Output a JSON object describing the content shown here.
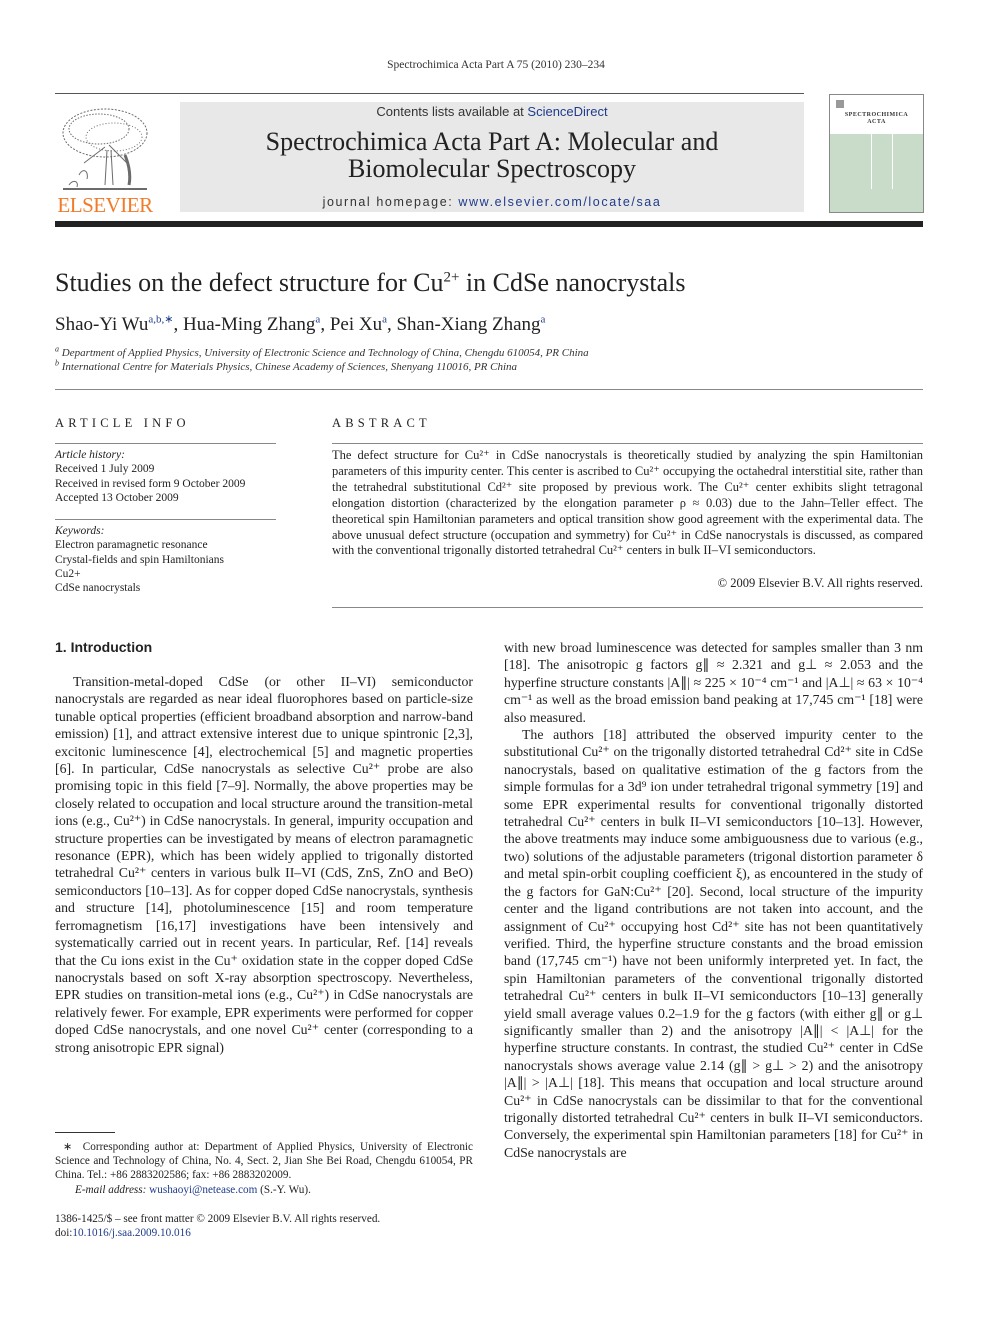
{
  "running_head": "Spectrochimica Acta Part A 75 (2010) 230–234",
  "banner": {
    "contents_prefix": "Contents lists available at ",
    "contents_link": "ScienceDirect",
    "journal_title_line1": "Spectrochimica Acta Part A: Molecular and",
    "journal_title_line2": "Biomolecular Spectroscopy",
    "homepage_prefix": "journal homepage: ",
    "homepage_link": "www.elsevier.com/locate/saa"
  },
  "publisher_logo": {
    "text": "ELSEVIER",
    "icon": "tree-icon",
    "color": "#f07b2a"
  },
  "cover": {
    "name_line1": "SPECTROCHIMICA",
    "name_line2": "ACTA",
    "color": "#c8dcc9"
  },
  "article": {
    "title_pre": "Studies on the defect structure for Cu",
    "title_sup": "2+",
    "title_post": " in CdSe nanocrystals",
    "authors": [
      {
        "name": "Shao-Yi Wu",
        "marks": "a,b,∗"
      },
      {
        "name": "Hua-Ming Zhang",
        "marks": "a"
      },
      {
        "name": "Pei Xu",
        "marks": "a"
      },
      {
        "name": "Shan-Xiang Zhang",
        "marks": "a"
      }
    ],
    "affiliations": [
      {
        "mark": "a",
        "text": "Department of Applied Physics, University of Electronic Science and Technology of China, Chengdu 610054, PR China"
      },
      {
        "mark": "b",
        "text": "International Centre for Materials Physics, Chinese Academy of Sciences, Shenyang 110016, PR China"
      }
    ]
  },
  "article_info": {
    "heading": "ARTICLE INFO",
    "history_label": "Article history:",
    "history": [
      "Received 1 July 2009",
      "Received in revised form 9 October 2009",
      "Accepted 13 October 2009"
    ],
    "keywords_label": "Keywords:",
    "keywords": [
      "Electron paramagnetic resonance",
      "Crystal-fields and spin Hamiltonians",
      "Cu2+",
      "CdSe nanocrystals"
    ]
  },
  "abstract": {
    "heading": "ABSTRACT",
    "text": "The defect structure for Cu²⁺ in CdSe nanocrystals is theoretically studied by analyzing the spin Hamiltonian parameters of this impurity center. This center is ascribed to Cu²⁺ occupying the octahedral interstitial site, rather than the tetrahedral substitutional Cd²⁺ site proposed by previous work. The Cu²⁺ center exhibits slight tetragonal elongation distortion (characterized by the elongation parameter ρ ≈ 0.03) due to the Jahn–Teller effect. The theoretical spin Hamiltonian parameters and optical transition show good agreement with the experimental data. The above unusual defect structure (occupation and symmetry) for Cu²⁺ in CdSe nanocrystals is discussed, as compared with the conventional trigonally distorted tetrahedral Cu²⁺ centers in bulk II–VI semiconductors.",
    "copyright": "© 2009 Elsevier B.V. All rights reserved."
  },
  "body": {
    "section_heading": "1.  Introduction",
    "left_column": "Transition-metal-doped CdSe (or other II–VI) semiconductor nanocrystals are regarded as near ideal fluorophores based on particle-size tunable optical properties (efficient broadband absorption and narrow-band emission) [1], and attract extensive interest due to unique spintronic [2,3], excitonic luminescence [4], electrochemical [5] and magnetic properties [6]. In particular, CdSe nanocrystals as selective Cu²⁺ probe are also promising topic in this field [7–9]. Normally, the above properties may be closely related to occupation and local structure around the transition-metal ions (e.g., Cu²⁺) in CdSe nanocrystals. In general, impurity occupation and structure properties can be investigated by means of electron paramagnetic resonance (EPR), which has been widely applied to trigonally distorted tetrahedral Cu²⁺ centers in various bulk II–VI (CdS, ZnS, ZnO and BeO) semiconductors [10–13]. As for copper doped CdSe nanocrystals, synthesis and structure [14], photoluminescence [15] and room temperature ferromagnetism [16,17] investigations have been intensively and systematically carried out in recent years. In particular, Ref. [14] reveals that the Cu ions exist in the Cu⁺ oxidation state in the copper doped CdSe nanocrystals based on soft X-ray absorption spectroscopy. Nevertheless, EPR studies on transition-metal ions (e.g., Cu²⁺) in CdSe nanocrystals are relatively fewer. For example, EPR experiments were performed for copper doped CdSe nanocrystals, and one novel Cu²⁺ center (corresponding to a strong anisotropic EPR signal)",
    "right_column_p1": "with new broad luminescence was detected for samples smaller than 3 nm [18]. The anisotropic g factors g∥ ≈ 2.321 and g⊥ ≈ 2.053 and the hyperfine structure constants |A∥| ≈ 225 × 10⁻⁴ cm⁻¹ and |A⊥| ≈ 63 × 10⁻⁴ cm⁻¹ as well as the broad emission band peaking at 17,745 cm⁻¹ [18] were also measured.",
    "right_column_p2": "The authors [18] attributed the observed impurity center to the substitutional Cu²⁺ on the trigonally distorted tetrahedral Cd²⁺ site in CdSe nanocrystals, based on qualitative estimation of the g factors from the simple formulas for a 3d⁹ ion under tetrahedral trigonal symmetry [19] and some EPR experimental results for conventional trigonally distorted tetrahedral Cu²⁺ centers in bulk II–VI semiconductors [10–13]. However, the above treatments may induce some ambiguousness due to various (e.g., two) solutions of the adjustable parameters (trigonal distortion parameter δ and metal spin-orbit coupling coefficient ξ), as encountered in the study of the g factors for GaN:Cu²⁺ [20]. Second, local structure of the impurity center and the ligand contributions are not taken into account, and the assignment of Cu²⁺ occupying host Cd²⁺ site has not been quantitatively verified. Third, the hyperfine structure constants and the broad emission band (17,745 cm⁻¹) have not been uniformly interpreted yet. In fact, the spin Hamiltonian parameters of the conventional trigonally distorted tetrahedral Cu²⁺ centers in bulk II–VI semiconductors [10–13] generally yield small average values 0.2–1.9 for the g factors (with either g∥ or g⊥ significantly smaller than 2) and the anisotropy |A∥| < |A⊥| for the hyperfine structure constants. In contrast, the studied Cu²⁺ center in CdSe nanocrystals shows average value 2.14 (g∥ > g⊥ > 2) and the anisotropy |A∥| > |A⊥| [18]. This means that occupation and local structure around Cu²⁺ in CdSe nanocrystals can be dissimilar to that for the conventional trigonally distorted tetrahedral Cu²⁺ centers in bulk II–VI semiconductors. Conversely, the experimental spin Hamiltonian parameters [18] for Cu²⁺ in CdSe nanocrystals are"
  },
  "footnote": {
    "mark": "∗",
    "text": "Corresponding author at: Department of Applied Physics, University of Electronic Science and Technology of China, No. 4, Sect. 2, Jian She Bei Road, Chengdu 610054, PR China. Tel.: +86 2883202586; fax: +86 2883202009.",
    "email_label": "E-mail address: ",
    "email": "wushaoyi@netease.com",
    "email_suffix": " (S.-Y. Wu)."
  },
  "front_matter": {
    "issn_line": "1386-1425/$ – see front matter © 2009 Elsevier B.V. All rights reserved.",
    "doi_label": "doi:",
    "doi": "10.1016/j.saa.2009.10.016"
  }
}
